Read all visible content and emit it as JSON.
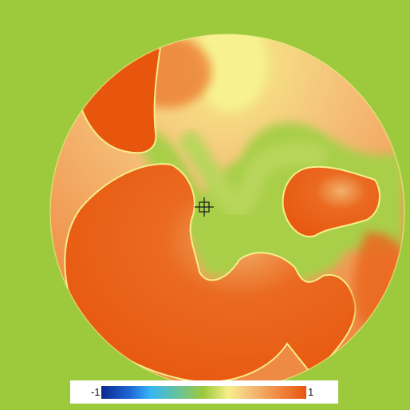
{
  "colors": {
    "background": "#9dc93c",
    "high": "#e8560e",
    "mid_high": "#f5c27a",
    "mid": "#f6ef8a",
    "neutral": "#9dc93c",
    "low": "#36b6f4",
    "lowest": "#0b2a8f"
  },
  "colorbar": {
    "min_label": "-1",
    "max_label": "1"
  },
  "icons": {
    "probe": "crosshair-icon"
  }
}
